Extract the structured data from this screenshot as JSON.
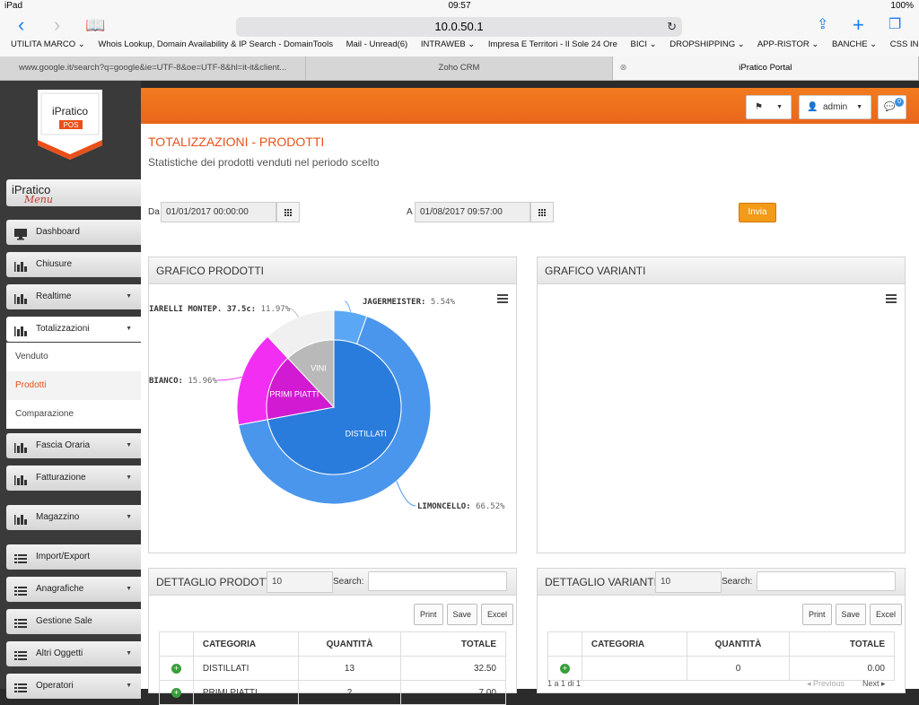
{
  "status": {
    "device": "iPad",
    "time": "09:57",
    "battery": "100%"
  },
  "browser": {
    "url": "10.0.50.1",
    "bookmarks": [
      "UTILITA MARCO ⌄",
      "Whois Lookup, Domain Availability & IP Search - DomainTools",
      "Mail - Unread(6)",
      "INTRAWEB ⌄",
      "Impresa E Territori - Il Sole 24 Ore",
      "BICI ⌄",
      "DROPSHIPPING ⌄",
      "APP-RISTOR ⌄",
      "BANCHE ⌄",
      "CSS INFO ⌄"
    ],
    "tabs": [
      "www.google.it/search?q=google&ie=UTF-8&oe=UTF-8&hl=it-it&client...",
      "Zoho CRM",
      "iPratico Portal"
    ]
  },
  "sidebar": {
    "logo": {
      "top": "iPratico",
      "sub": "POS"
    },
    "brand": {
      "line1": "iPratico",
      "line2": "Menu"
    },
    "items": [
      {
        "label": "Dashboard",
        "arrow": ""
      },
      {
        "label": "Chiusure",
        "arrow": ""
      },
      {
        "label": "Realtime",
        "arrow": "▼"
      },
      {
        "label": "Totalizzazioni",
        "arrow": "▼"
      },
      {
        "label": "Fascia Oraria",
        "arrow": "▼"
      },
      {
        "label": "Fatturazione",
        "arrow": "▼"
      },
      {
        "label": "Magazzino",
        "arrow": "▼"
      },
      {
        "label": "Import/Export",
        "arrow": ""
      },
      {
        "label": "Anagrafiche",
        "arrow": "▼"
      },
      {
        "label": "Gestione Sale",
        "arrow": ""
      },
      {
        "label": "Altri Oggetti",
        "arrow": "▼"
      },
      {
        "label": "Operatori",
        "arrow": "▼"
      }
    ],
    "submenu": [
      "Venduto",
      "Prodotti",
      "Comparazione"
    ]
  },
  "topbar": {
    "user": "admin",
    "notifications": "0"
  },
  "page": {
    "title": "TOTALIZZAZIONI - PRODOTTI",
    "subtitle": "Statistiche dei prodotti venduti nel periodo scelto",
    "from_label": "Da",
    "from_value": "01/01/2017  00:00:00",
    "to_label": "A",
    "to_value": "01/08/2017 09:57:00",
    "submit": "Invia"
  },
  "chart_panel": {
    "title": "GRAFICO PRODOTTI"
  },
  "variant_panel": {
    "title": "GRAFICO VARIANTI"
  },
  "chart_data": {
    "type": "pie",
    "inner": [
      {
        "name": "DISTILLATI",
        "value": 72.06,
        "color": "#2a7cdc"
      },
      {
        "name": "PRIMI PIATTI",
        "value": 15.96,
        "color": "#d21ad2"
      },
      {
        "name": "VINI",
        "value": 11.97,
        "color": "#b9b9b9"
      }
    ],
    "outer": [
      {
        "name": "JAGERMEISTER",
        "value": 5.54,
        "color": "#5aa8f5"
      },
      {
        "name": "LIMONCELLO",
        "value": 66.52,
        "color": "#4a96ec"
      },
      {
        "name": "BIANCO",
        "value": 15.96,
        "color": "#f22ef2"
      },
      {
        "name": "IARELLI MONTEP. 37.5c",
        "value": 11.97,
        "color": "#f0f0f0"
      }
    ],
    "labels": [
      {
        "name": "JAGERMEISTER",
        "pct": "5.54%"
      },
      {
        "name": "IARELLI MONTEP. 37.5c",
        "pct": "11.97%"
      },
      {
        "name": "BIANCO",
        "pct": "15.96%"
      },
      {
        "name": "LIMONCELLO",
        "pct": "66.52%"
      }
    ]
  },
  "prod_table": {
    "title": "DETTAGLIO PRODOTTI",
    "page_size": "10",
    "search_label": "Search:",
    "buttons": [
      "Print",
      "Save",
      "Excel"
    ],
    "headers": [
      "",
      "CATEGORIA",
      "QUANTITÀ",
      "TOTALE"
    ],
    "rows": [
      [
        "DISTILLATI",
        "13",
        "32.50"
      ],
      [
        "PRIMI PIATTI",
        "2",
        "7.00"
      ]
    ]
  },
  "var_table": {
    "title": "DETTAGLIO VARIANTI",
    "page_size": "10",
    "search_label": "Search:",
    "buttons": [
      "Print",
      "Save",
      "Excel"
    ],
    "headers": [
      "",
      "CATEGORIA",
      "QUANTITÀ",
      "TOTALE"
    ],
    "rows": [
      [
        "",
        "0",
        "0.00"
      ]
    ],
    "info": "1 a 1 di 1",
    "prev": "Previous",
    "next": "Next"
  }
}
